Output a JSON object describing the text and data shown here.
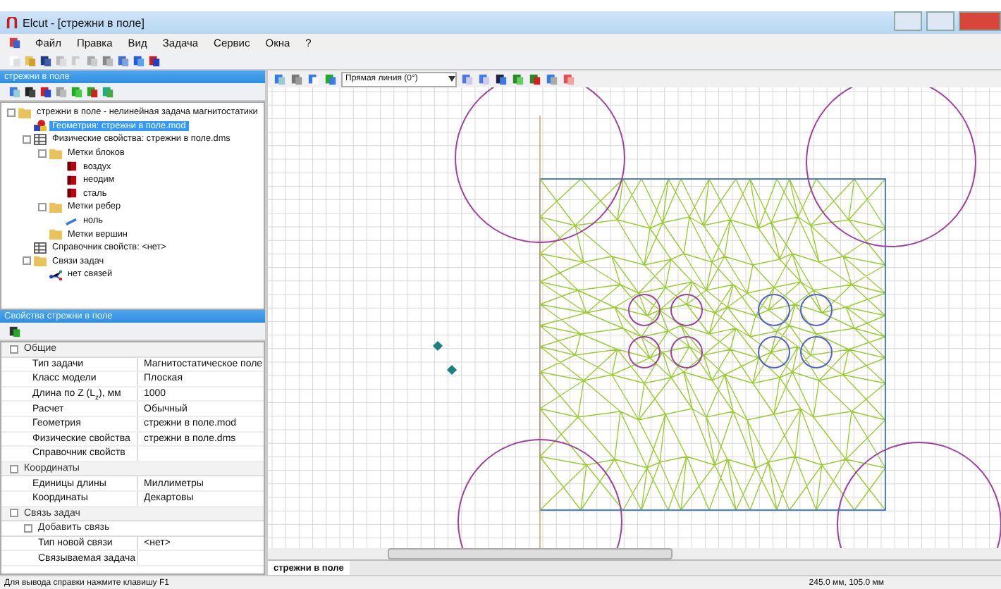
{
  "window": {
    "title": "Elcut - [стрежни в поле]"
  },
  "menu": [
    "Файл",
    "Правка",
    "Вид",
    "Задача",
    "Сервис",
    "Окна",
    "?"
  ],
  "tree_panel": {
    "title": "стрежни в поле"
  },
  "tree": [
    {
      "label": "стрежни в поле - нелинейная задача магнитостатики",
      "kind": "folder",
      "selected": false,
      "expanded": true,
      "children": [
        {
          "label": "Геометрия: стрежни в поле.mod",
          "kind": "geometry",
          "selected": true
        },
        {
          "label": "Физические свойства: стрежни в поле.dms",
          "kind": "table",
          "selected": false,
          "expanded": true,
          "children": [
            {
              "label": "Метки блоков",
              "kind": "folder",
              "selected": false,
              "expanded": true,
              "children": [
                {
                  "label": "воздух",
                  "kind": "block",
                  "selected": false
                },
                {
                  "label": "неодим",
                  "kind": "block",
                  "selected": false
                },
                {
                  "label": "сталь",
                  "kind": "block",
                  "selected": false
                }
              ]
            },
            {
              "label": "Метки ребер",
              "kind": "folder",
              "selected": false,
              "expanded": true,
              "children": [
                {
                  "label": "ноль",
                  "kind": "edge",
                  "selected": false
                }
              ]
            },
            {
              "label": "Метки вершин",
              "kind": "folder",
              "selected": false
            }
          ]
        },
        {
          "label": "Справочник свойств: <нет>",
          "kind": "table",
          "selected": false
        },
        {
          "label": "Связи задач",
          "kind": "folder",
          "selected": false,
          "expanded": true,
          "children": [
            {
              "label": "нет связей",
              "kind": "link",
              "selected": false
            }
          ]
        }
      ]
    }
  ],
  "properties_panel": {
    "title": "Свойства стрежни в поле"
  },
  "properties": [
    {
      "kind": "group",
      "label": "Общие"
    },
    {
      "kind": "row",
      "name": "Тип задачи",
      "value": "Магнитостатическое поле"
    },
    {
      "kind": "row",
      "name": "Класс модели",
      "value": "Плоская"
    },
    {
      "kind": "row",
      "name": "Длина по Z (L$_{z}$), мм",
      "value": "1000"
    },
    {
      "kind": "row",
      "name": "Расчет",
      "value": "Обычный"
    },
    {
      "kind": "row",
      "name": "Геометрия",
      "value": "стрежни в поле.mod"
    },
    {
      "kind": "row",
      "name": "Физические свойства",
      "value": "стрежни в поле.dms"
    },
    {
      "kind": "row",
      "name": "Справочник свойств"
    },
    {
      "kind": "group",
      "label": "Координаты"
    },
    {
      "kind": "row",
      "name": "Единицы длины",
      "value": "Миллиметры"
    },
    {
      "kind": "row",
      "name": "Координаты",
      "value": "Декартовы"
    },
    {
      "kind": "group",
      "label": "Связь задач"
    },
    {
      "kind": "subgroup",
      "label": "Добавить связь"
    },
    {
      "kind": "subrow",
      "name": "Тип новой связи",
      "value": "<нет>"
    },
    {
      "kind": "subrow",
      "name": "Связываемая задача"
    }
  ],
  "canvas_toolbar": {
    "line_type": "Прямая линия (0°)"
  },
  "document_tabs": [
    {
      "label": "стрежни в поле",
      "selected": true
    }
  ],
  "status_bar": {
    "hint": "Для вывода справки нажмите клавишу F1",
    "coordinates": "245.0 мм, 105.0 мм"
  }
}
